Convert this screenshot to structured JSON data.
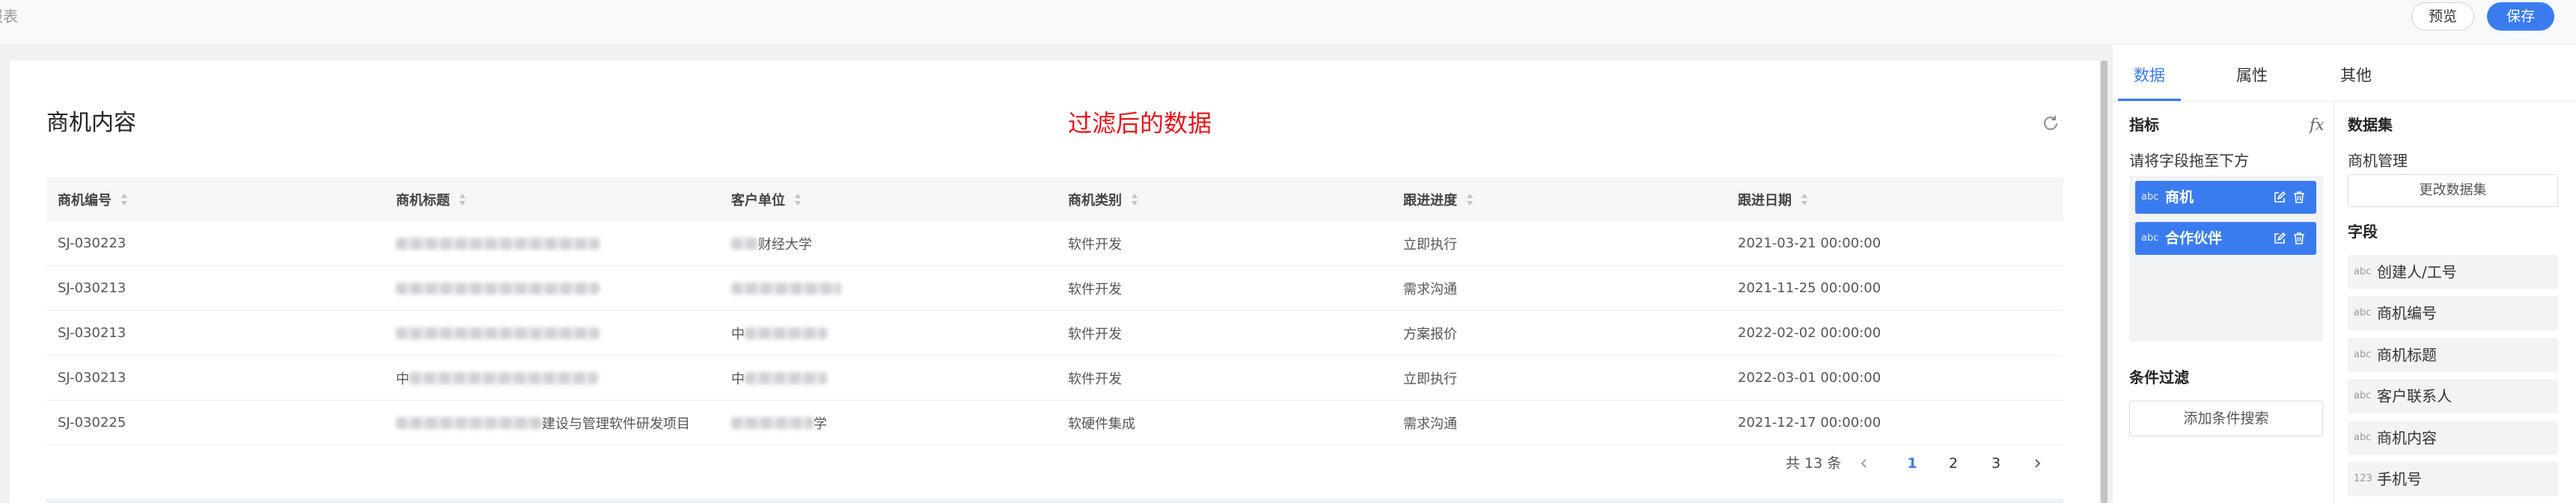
{
  "app": {
    "title": "报表"
  },
  "toolbar": {
    "preview_label": "预览",
    "save_label": "保存"
  },
  "card": {
    "title": "商机内容",
    "annotation": "过滤后的数据",
    "columns": [
      "商机编号",
      "商机标题",
      "客户单位",
      "商机类别",
      "跟进进度",
      "跟进日期"
    ],
    "rows": [
      {
        "id": "SJ-030223",
        "customer": "财经大学",
        "category": "软件开发",
        "progress": "立即执行",
        "date": "2021-03-21 00:00:00"
      },
      {
        "id": "SJ-030213",
        "category": "软件开发",
        "progress": "需求沟通",
        "date": "2021-11-25 00:00:00"
      },
      {
        "id": "SJ-030213",
        "customer": "中",
        "category": "软件开发",
        "progress": "方案报价",
        "date": "2022-02-02 00:00:00"
      },
      {
        "id": "SJ-030213",
        "title": "中",
        "customer": "中",
        "category": "软件开发",
        "progress": "立即执行",
        "date": "2022-03-01 00:00:00"
      },
      {
        "id": "SJ-030225",
        "title": "建设与管理软件研发项目",
        "customer": "学",
        "category": "软硬件集成",
        "progress": "需求沟通",
        "date": "2021-12-17 00:00:00"
      }
    ],
    "pagination": {
      "total_text": "共 13 条",
      "pages": [
        "1",
        "2",
        "3"
      ],
      "current_page": 1
    }
  },
  "panel": {
    "tabs": [
      "数据",
      "属性",
      "其他"
    ],
    "active_tab_index": 0,
    "metrics": {
      "title": "指标",
      "fx_label": "fx",
      "hint": "请将字段拖至下方",
      "chips": [
        {
          "type": "abc",
          "label": "商机"
        },
        {
          "type": "abc",
          "label": "合作伙伴"
        }
      ]
    },
    "filter": {
      "title": "条件过滤",
      "add_label": "添加条件搜索"
    },
    "dataset": {
      "title": "数据集",
      "name": "商机管理",
      "change_label": "更改数据集"
    },
    "fields": {
      "title": "字段",
      "items": [
        {
          "type": "abc",
          "label": "创建人/工号"
        },
        {
          "type": "abc",
          "label": "商机编号"
        },
        {
          "type": "abc",
          "label": "商机标题"
        },
        {
          "type": "abc",
          "label": "客户联系人"
        },
        {
          "type": "abc",
          "label": "商机内容"
        },
        {
          "type": "123",
          "label": "手机号"
        }
      ]
    }
  },
  "colors": {
    "accent": "#3a7cf0",
    "annotation": "#e8131b",
    "page_bg": "#f0f1f3"
  },
  "icons": {
    "refresh": "refresh-icon",
    "sort": "sort-icon",
    "edit": "edit-icon",
    "delete": "delete-icon",
    "prev": "chevron-left-icon",
    "next": "chevron-right-icon"
  }
}
